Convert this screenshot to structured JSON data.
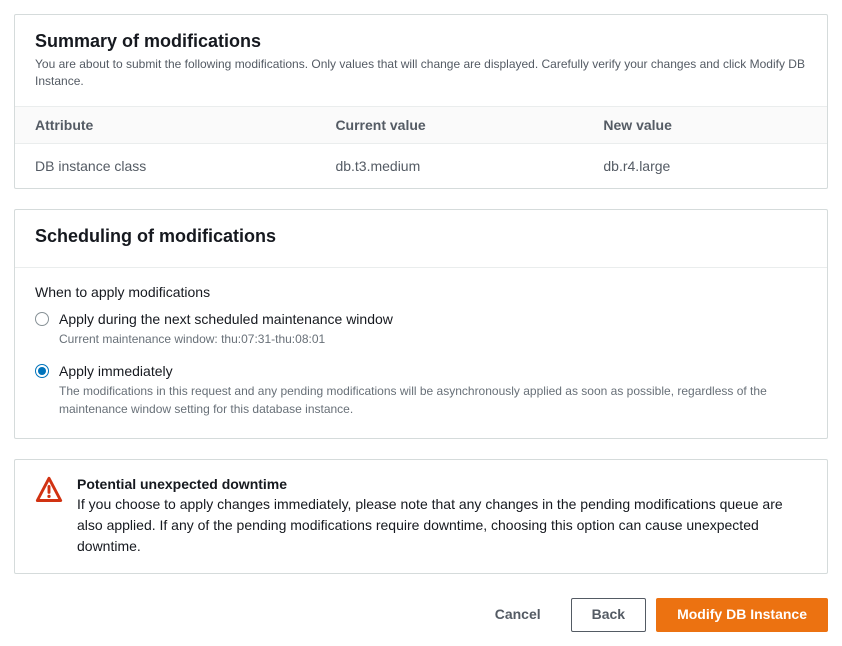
{
  "summary": {
    "title": "Summary of modifications",
    "description": "You are about to submit the following modifications. Only values that will change are displayed. Carefully verify your changes and click Modify DB Instance."
  },
  "table": {
    "headers": {
      "attribute": "Attribute",
      "current": "Current value",
      "new": "New value"
    },
    "rows": [
      {
        "attribute": "DB instance class",
        "current": "db.t3.medium",
        "new": "db.r4.large"
      }
    ]
  },
  "scheduling": {
    "title": "Scheduling of modifications",
    "field_label": "When to apply modifications",
    "options": [
      {
        "title": "Apply during the next scheduled maintenance window",
        "desc": "Current maintenance window: thu:07:31-thu:08:01",
        "selected": false
      },
      {
        "title": "Apply immediately",
        "desc": "The modifications in this request and any pending modifications will be asynchronously applied as soon as possible, regardless of the maintenance window setting for this database instance.",
        "selected": true
      }
    ]
  },
  "alert": {
    "title": "Potential unexpected downtime",
    "text": "If you choose to apply changes immediately, please note that any changes in the pending modifications queue are also applied. If any of the pending modifications require downtime, choosing this option can cause unexpected downtime."
  },
  "buttons": {
    "cancel": "Cancel",
    "back": "Back",
    "modify": "Modify DB Instance"
  }
}
